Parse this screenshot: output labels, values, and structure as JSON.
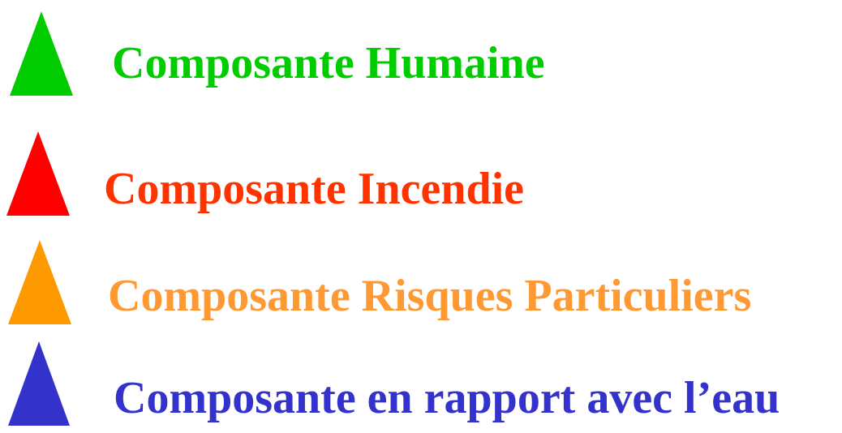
{
  "legend": {
    "items": [
      {
        "icon": "triangle-icon",
        "color": "#00cc00",
        "label": "Composante Humaine"
      },
      {
        "icon": "triangle-icon",
        "color": "#ff0000",
        "label": "Composante Incendie"
      },
      {
        "icon": "triangle-icon",
        "color": "#ff9900",
        "label": "Composante Risques Particuliers"
      },
      {
        "icon": "triangle-icon",
        "color": "#3333cc",
        "label": "Composante en rapport avec l’eau"
      }
    ],
    "label_colors": [
      "#00cc00",
      "#ff3300",
      "#ff9933",
      "#3333cc"
    ]
  }
}
